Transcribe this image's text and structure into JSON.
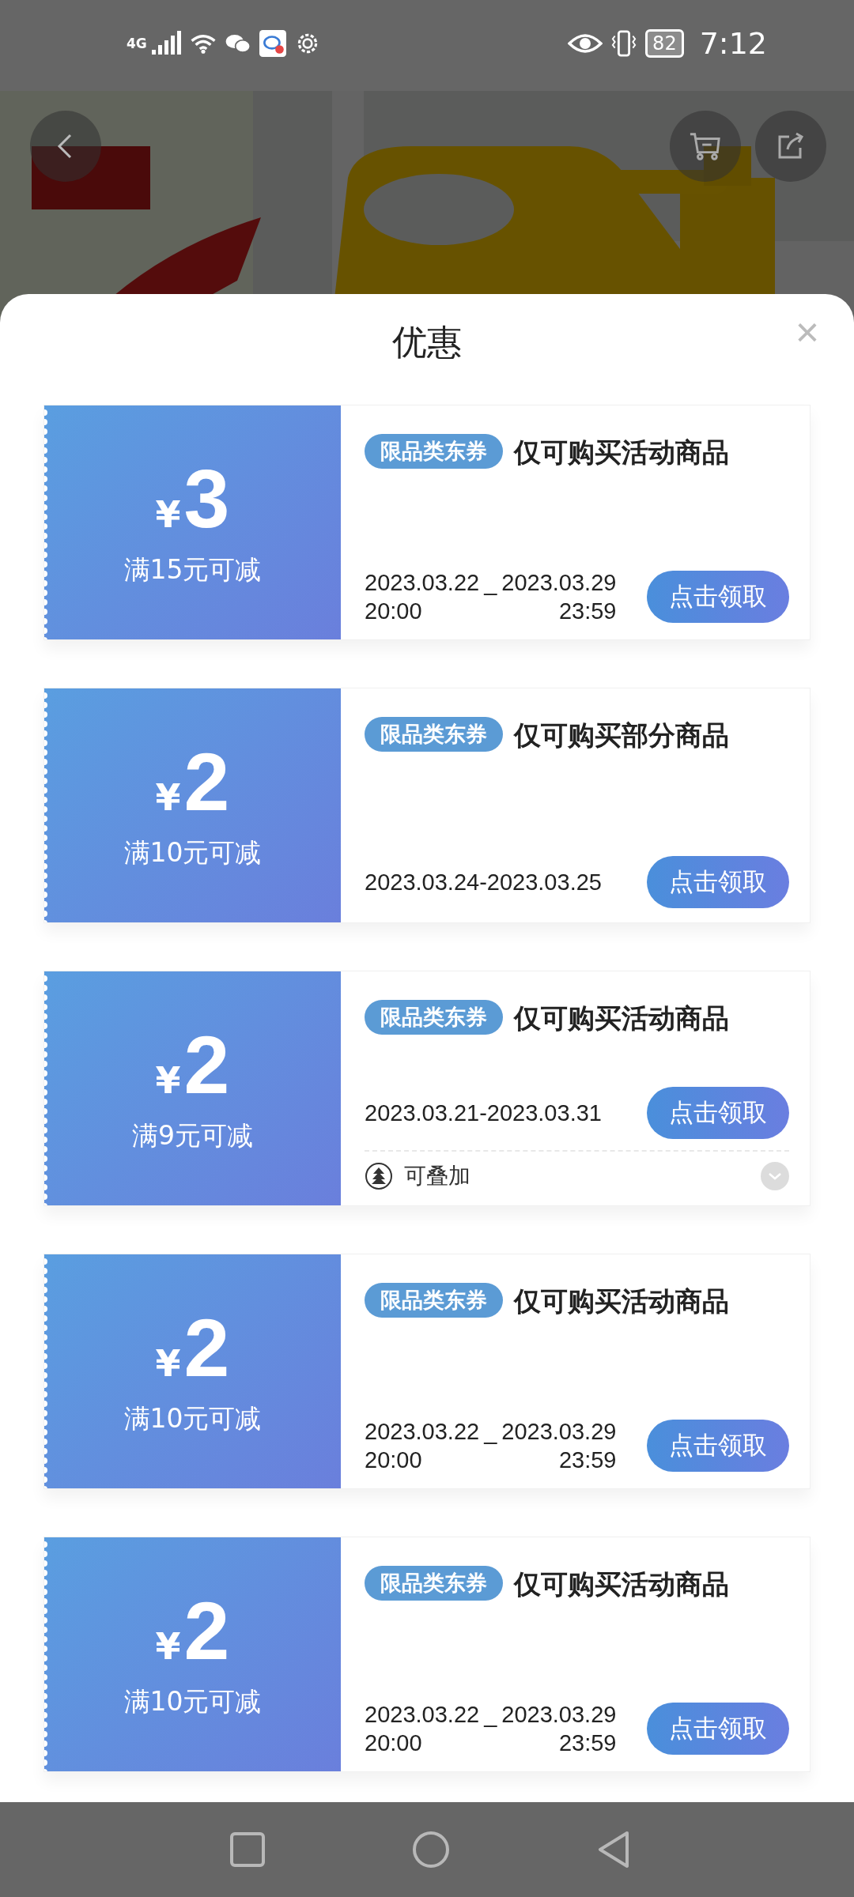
{
  "status_bar": {
    "network": "4G",
    "battery": "82",
    "time": "7:12"
  },
  "sheet": {
    "title": "优惠",
    "close": "×"
  },
  "coupons": [
    {
      "currency": "¥",
      "amount": "3",
      "condition": "满15元可减",
      "tag": "限品类东券",
      "title": "仅可购买活动商品",
      "kind": "columns",
      "start_date": "2023.03.22",
      "start_time": "20:00",
      "separator": "_",
      "end_date": "2023.03.29",
      "end_time": "23:59",
      "button": "点击领取"
    },
    {
      "currency": "¥",
      "amount": "2",
      "condition": "满10元可减",
      "tag": "限品类东券",
      "title": "仅可购买部分商品",
      "kind": "line",
      "date": "2023.03.24-2023.03.25",
      "button": "点击领取"
    },
    {
      "currency": "¥",
      "amount": "2",
      "condition": "满9元可减",
      "tag": "限品类东券",
      "title": "仅可购买活动商品",
      "kind": "line",
      "date": "2023.03.21-2023.03.31",
      "button": "点击领取",
      "stackable": {
        "label": "可叠加",
        "expanded": false
      }
    },
    {
      "currency": "¥",
      "amount": "2",
      "condition": "满10元可减",
      "tag": "限品类东券",
      "title": "仅可购买活动商品",
      "kind": "columns",
      "start_date": "2023.03.22",
      "start_time": "20:00",
      "separator": "_",
      "end_date": "2023.03.29",
      "end_time": "23:59",
      "button": "点击领取"
    },
    {
      "currency": "¥",
      "amount": "2",
      "condition": "满10元可减",
      "tag": "限品类东券",
      "title": "仅可购买活动商品",
      "kind": "columns",
      "start_date": "2023.03.22",
      "start_time": "20:00",
      "separator": "_",
      "end_date": "2023.03.29",
      "end_time": "23:59",
      "button": "点击领取"
    }
  ]
}
